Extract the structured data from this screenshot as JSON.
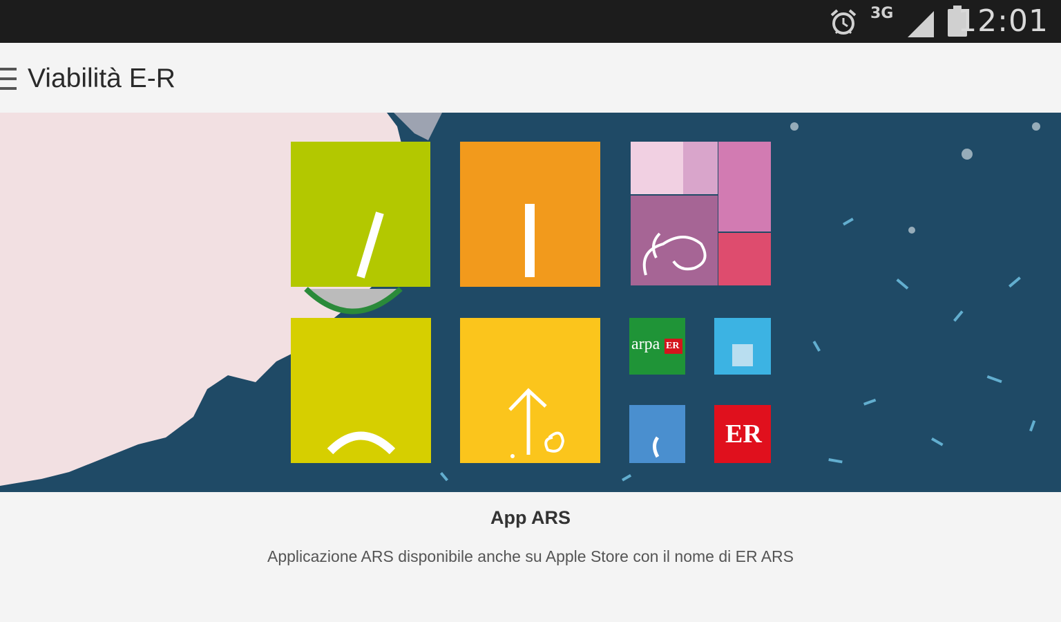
{
  "status_bar": {
    "time": "12:01",
    "network": "3G",
    "icons": [
      "alarm-icon",
      "network-3g-icon",
      "signal-icon",
      "battery-icon"
    ]
  },
  "app_bar": {
    "title": "Viabilità E-R",
    "menu_icon": "hamburger-menu-icon"
  },
  "banner": {
    "tiles": {
      "arpa_label": "arpa",
      "arpa_badge": "ER",
      "er_logo": "ER"
    },
    "colors": {
      "sea": "#1f4a66",
      "land": "#f2e0e2",
      "lime": "#b3c800",
      "orange": "#f29a1c",
      "yellow": "#d6cf00",
      "gold": "#fbc51c",
      "green": "#1f9437",
      "sky": "#3cb3e3",
      "blue": "#4a8fcf",
      "red": "#e0101d"
    }
  },
  "caption": {
    "title": "App ARS",
    "subtitle": "Applicazione ARS disponibile anche su Apple Store con il nome di ER ARS"
  }
}
